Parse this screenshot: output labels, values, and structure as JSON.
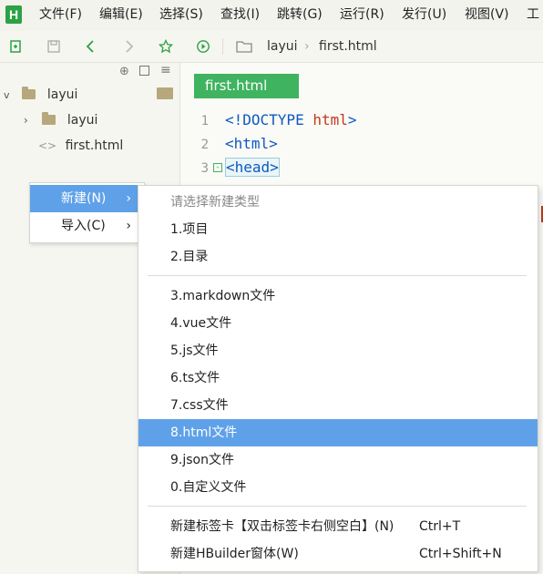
{
  "app": {
    "logo": "H"
  },
  "menubar": {
    "items": [
      "文件(F)",
      "编辑(E)",
      "选择(S)",
      "查找(I)",
      "跳转(G)",
      "运行(R)",
      "发行(U)",
      "视图(V)",
      "工"
    ]
  },
  "toolbar": {
    "icons": [
      "new-file-icon",
      "save-icon",
      "back-icon",
      "forward-icon",
      "star-icon",
      "run-icon"
    ],
    "breadcrumb": [
      "layui",
      "first.html"
    ]
  },
  "sidebar": {
    "tree": [
      {
        "label": "layui",
        "type": "folder",
        "expanded": true
      },
      {
        "label": "layui",
        "type": "folder",
        "expanded": false
      },
      {
        "label": "first.html",
        "type": "file"
      }
    ]
  },
  "editor": {
    "tab_label": "first.html",
    "lines": [
      {
        "num": "1",
        "open": "<!",
        "name": "DOCTYPE",
        "attr": " html",
        "close": ">"
      },
      {
        "num": "2",
        "open": "<",
        "name": "html",
        "close": ">"
      },
      {
        "num": "3",
        "open": "<",
        "name": "head",
        "close": ">"
      }
    ]
  },
  "context_menu": {
    "items": [
      {
        "label": "新建(N)",
        "arrow": "›"
      },
      {
        "label": "导入(C)",
        "arrow": "›"
      }
    ]
  },
  "submenu": {
    "header": "请选择新建类型",
    "group1": [
      "1.项目",
      "2.目录"
    ],
    "group2": [
      "3.markdown文件",
      "4.vue文件",
      "5.js文件",
      "6.ts文件",
      "7.css文件",
      "8.html文件",
      "9.json文件",
      "0.自定义文件"
    ],
    "group3": [
      {
        "label": "新建标签卡【双击标签卡右侧空白】(N)",
        "shortcut": "Ctrl+T"
      },
      {
        "label": "新建HBuilder窗体(W)",
        "shortcut": "Ctrl+Shift+N"
      }
    ],
    "selected": "8.html文件"
  },
  "colors": {
    "accent_green": "#3fb35f",
    "selection_blue": "#5fa1e9",
    "tag_blue": "#0e59c2",
    "keyword_red": "#c2391b"
  }
}
